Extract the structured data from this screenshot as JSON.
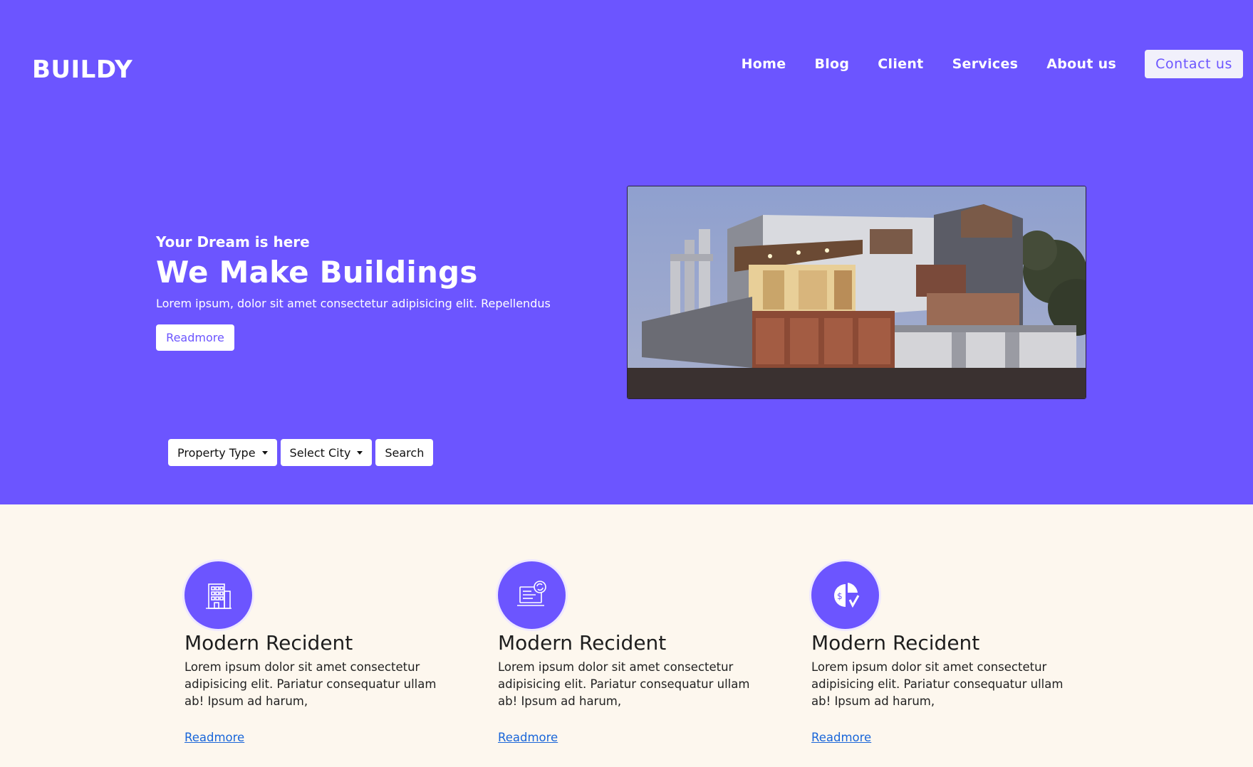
{
  "brand": {
    "logo": "BUILDY"
  },
  "nav": {
    "items": [
      "Home",
      "Blog",
      "Client",
      "Services",
      "About us"
    ],
    "contact": "Contact us"
  },
  "hero": {
    "tagline": "Your Dream is here",
    "headline": "We Make Buildings",
    "lead": "Lorem ipsum, dolor sit amet consectetur adipisicing elit. Repellendus",
    "button": "Readmore"
  },
  "filters": {
    "property_type": "Property Type",
    "city": "Select City",
    "search": "Search"
  },
  "features": [
    {
      "icon": "building-icon",
      "title": "Modern Recident",
      "text": "Lorem ipsum dolor sit amet consectetur adipisicing elit. Pariatur consequatur ullam ab! Ipsum ad harum,",
      "link": "Readmore"
    },
    {
      "icon": "laptop-sync-icon",
      "title": "Modern Recident",
      "text": "Lorem ipsum dolor sit amet consectetur adipisicing elit. Pariatur consequatur ullam ab! Ipsum ad harum,",
      "link": "Readmore"
    },
    {
      "icon": "dollar-chart-icon",
      "title": "Modern Recident",
      "text": "Lorem ipsum dolor sit amet consectetur adipisicing elit. Pariatur consequatur ullam ab! Ipsum ad harum,",
      "link": "Readmore"
    }
  ],
  "colors": {
    "primary": "#6c55ff",
    "section_bg": "#fdf7ee",
    "link": "#1a66d9"
  }
}
